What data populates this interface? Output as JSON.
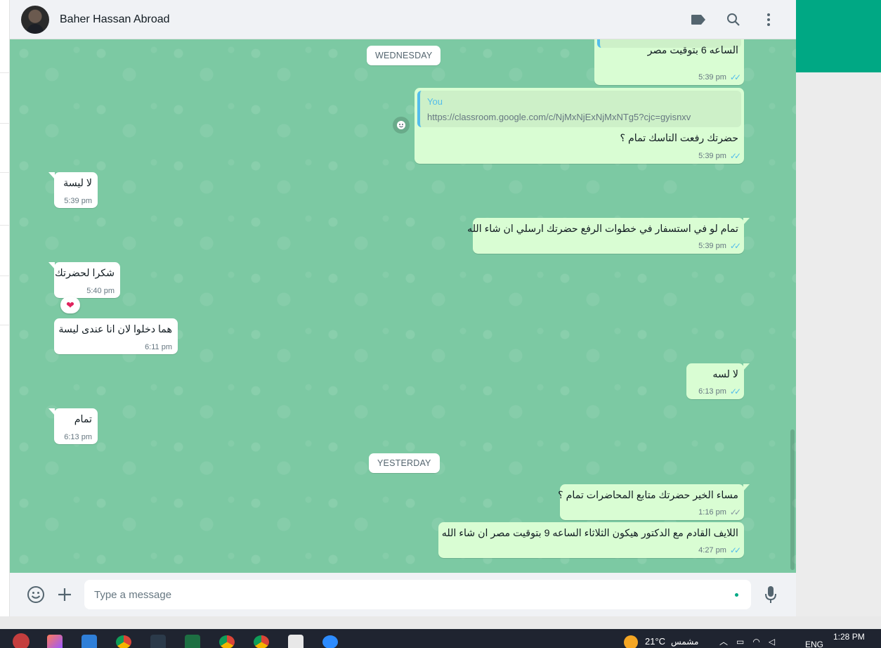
{
  "header": {
    "contact_name": "Baher Hassan Abroad",
    "icons": [
      "label-icon",
      "search-icon",
      "menu-icon"
    ]
  },
  "chat": {
    "date_separators": [
      "WEDNESDAY",
      "YESTERDAY"
    ],
    "messages": [
      {
        "dir": "out",
        "text": "الساعه 6 بتوقيت مصر",
        "time": "5:39 pm",
        "status": "read"
      },
      {
        "dir": "out",
        "quote_author": "You",
        "quote_text": "https://classroom.google.com/c/NjMxNjExNjMxNTg5?cjc=gyisnxv",
        "text": "حضرتك رفعت التاسك تمام ؟",
        "time": "5:39 pm",
        "status": "read"
      },
      {
        "dir": "in",
        "text": "لا ليسة",
        "time": "5:39 pm"
      },
      {
        "dir": "out",
        "text": "تمام لو في استسفار في خطوات الرفع حضرتك ارسلي ان شاء الله",
        "time": "5:39 pm",
        "status": "read"
      },
      {
        "dir": "in",
        "text": "شكرا لحضرتك",
        "time": "5:40 pm",
        "reaction": "❤"
      },
      {
        "dir": "in",
        "text": "هما دخلوا لان انا عندى ليسة",
        "time": "6:11 pm"
      },
      {
        "dir": "out",
        "text": "لا لسه",
        "time": "6:13 pm",
        "status": "read"
      },
      {
        "dir": "in",
        "text": "تمام",
        "time": "6:13 pm"
      },
      {
        "dir": "out",
        "text": "مساء الخير حضرتك متابع المحاضرات تمام ؟",
        "time": "1:16 pm",
        "status": "delivered"
      },
      {
        "dir": "out",
        "text": "اللايف القادم مع الدكتور  هيكون الثلاثاء الساعه 9 بتوقيت مصر ان شاء الله",
        "time": "4:27 pm",
        "status": "read"
      }
    ]
  },
  "footer": {
    "input_placeholder": "Type a message",
    "icons": [
      "emoji-icon",
      "attach-icon",
      "mic-icon"
    ]
  },
  "taskbar": {
    "weather_temp": "21°C",
    "weather_text": "مشمس",
    "language": "ENG",
    "time": "1:28 PM",
    "apps": [
      "start-icon",
      "app-icon",
      "photos-icon",
      "chrome-icon",
      "app-icon",
      "excel-icon",
      "chrome-icon",
      "chrome-icon",
      "pdf-icon",
      "zoom-icon"
    ]
  },
  "colors": {
    "outgoing_bubble": "#d9fdd3",
    "incoming_bubble": "#ffffff",
    "chat_bg": "#7cc9a3",
    "accent": "#00a884",
    "read_ticks": "#53bdeb"
  }
}
